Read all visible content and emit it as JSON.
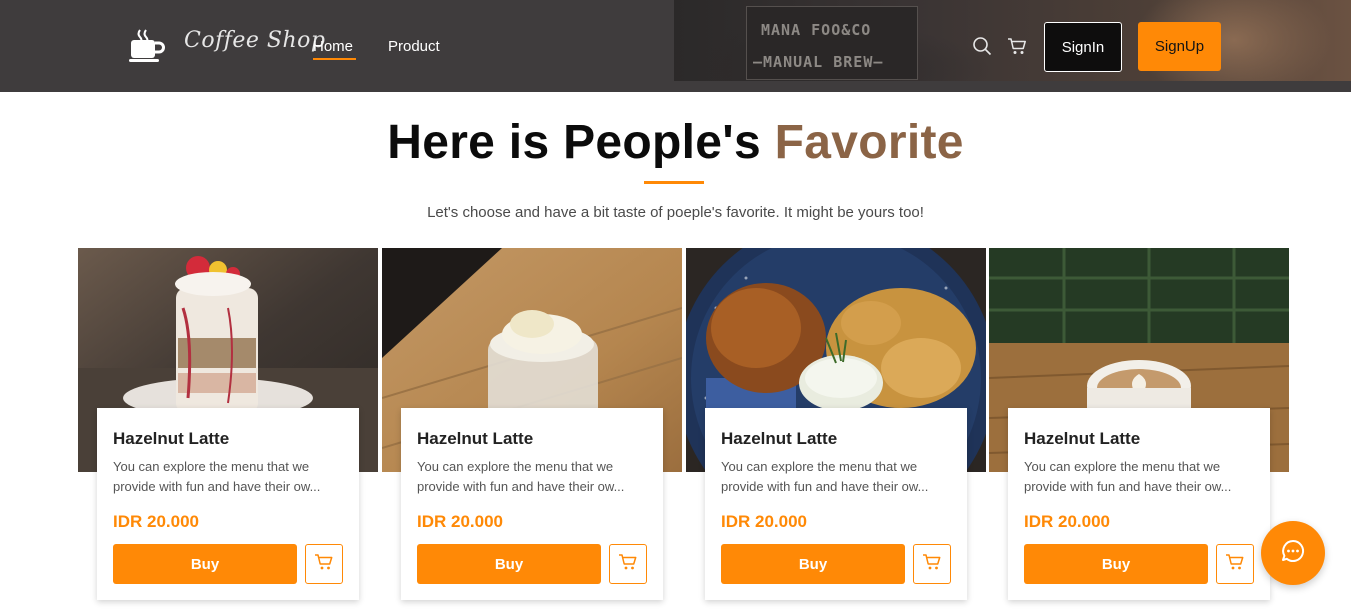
{
  "header": {
    "brand_name": "Coffee Shop",
    "nav": [
      {
        "label": "Home",
        "active": true
      },
      {
        "label": "Product",
        "active": false
      }
    ],
    "photo_sign_lines": [
      "MANA FOO&CO",
      "—MANUAL BREW—"
    ],
    "icons": [
      "coffee-cup-icon",
      "search-icon",
      "cart-icon"
    ],
    "signin_label": "SignIn",
    "signup_label": "SignUp"
  },
  "section": {
    "title_main": "Here is People's",
    "title_accent": "Favorite",
    "subtitle": "Let's choose and have a bit taste of poeple's favorite. It might be yours too!"
  },
  "products": [
    {
      "title": "Hazelnut Latte",
      "description": "You can explore the menu that we provide with fun and have their ow...",
      "price": "IDR 20.000",
      "buy_label": "Buy",
      "image": "parfait-dessert"
    },
    {
      "title": "Hazelnut Latte",
      "description": "You can explore the menu that we provide with fun and have their ow...",
      "price": "IDR 20.000",
      "buy_label": "Buy",
      "image": "cream-drink"
    },
    {
      "title": "Hazelnut Latte",
      "description": "You can explore the menu that we provide with fun and have their ow...",
      "price": "IDR 20.000",
      "buy_label": "Buy",
      "image": "fried-chicken-chips"
    },
    {
      "title": "Hazelnut Latte",
      "description": "You can explore the menu that we provide with fun and have their ow...",
      "price": "IDR 20.000",
      "buy_label": "Buy",
      "image": "latte-art-cup"
    }
  ],
  "chat": {
    "icon": "chat-icon"
  },
  "colors": {
    "accent": "#ff8906",
    "header_bg": "#3f3c3d",
    "title_accent": "#8b6446"
  }
}
